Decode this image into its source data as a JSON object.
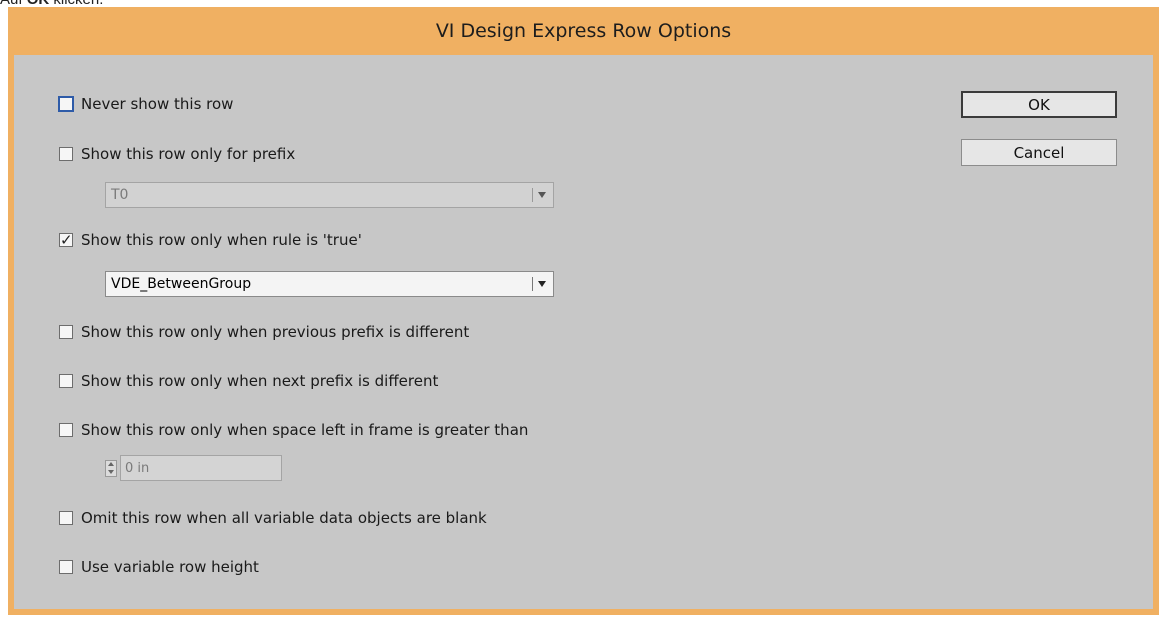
{
  "caption": {
    "prefix": "Auf ",
    "bold": "OK",
    "suffix": " klicken."
  },
  "window": {
    "title": "VI Design Express Row Options"
  },
  "buttons": {
    "ok": "OK",
    "cancel": "Cancel"
  },
  "options": {
    "never_show": {
      "label": "Never show this row",
      "checked": false
    },
    "prefix": {
      "label": "Show this row only for prefix",
      "checked": false,
      "value": "T0"
    },
    "rule": {
      "label": "Show this row only when rule is 'true'",
      "checked": true,
      "value": "VDE_BetweenGroup"
    },
    "prev_prefix": {
      "label": "Show this row only when previous prefix is different",
      "checked": false
    },
    "next_prefix": {
      "label": "Show this row only when next prefix is different",
      "checked": false
    },
    "space_left": {
      "label": "Show this row only when space left in frame is greater than",
      "checked": false,
      "value": "0 in"
    },
    "omit_blank": {
      "label": "Omit this row when all variable data objects are blank",
      "checked": false
    },
    "variable_height": {
      "label": "Use variable row height",
      "checked": false
    }
  },
  "glyphs": {
    "check": "✓"
  }
}
